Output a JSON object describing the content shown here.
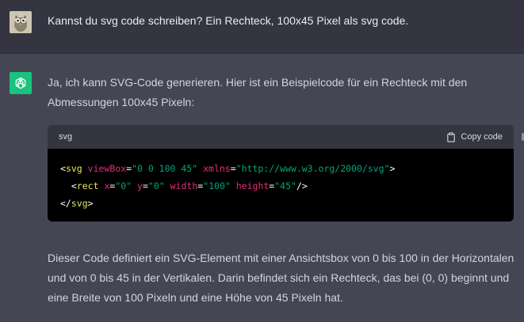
{
  "user_message": {
    "avatar_icon": "user-avatar-icon",
    "text": "Kannst du svg code schreiben? Ein Rechteck, 100x45 Pixel als svg code."
  },
  "assistant_message": {
    "avatar_icon": "openai-logo-icon",
    "intro": "Ja, ich kann SVG-Code generieren. Hier ist ein Beispielcode für ein Rechteck mit den Abmessungen 100x45 Pixeln:",
    "code_block": {
      "language": "svg",
      "copy_label": "Copy code",
      "copy_icon": "clipboard-icon",
      "lines": [
        "<svg viewBox=\"0 0 100 45\" xmlns=\"http://www.w3.org/2000/svg\">",
        "  <rect x=\"0\" y=\"0\" width=\"100\" height=\"45\"/>",
        "</svg>"
      ]
    },
    "explanation": "Dieser Code definiert ein SVG-Element mit einer Ansichtsbox von 0 bis 100 in der Horizontalen und von 0 bis 45 in der Vertikalen. Darin befindet sich ein Rechteck, das bei (0, 0) beginnt und eine Breite von 100 Pixeln und eine Höhe von 45 Pixeln hat."
  },
  "colors": {
    "user_bg": "#343541",
    "assistant_bg": "#444654",
    "brand_green": "#19c37d",
    "code_bg": "#000000"
  }
}
